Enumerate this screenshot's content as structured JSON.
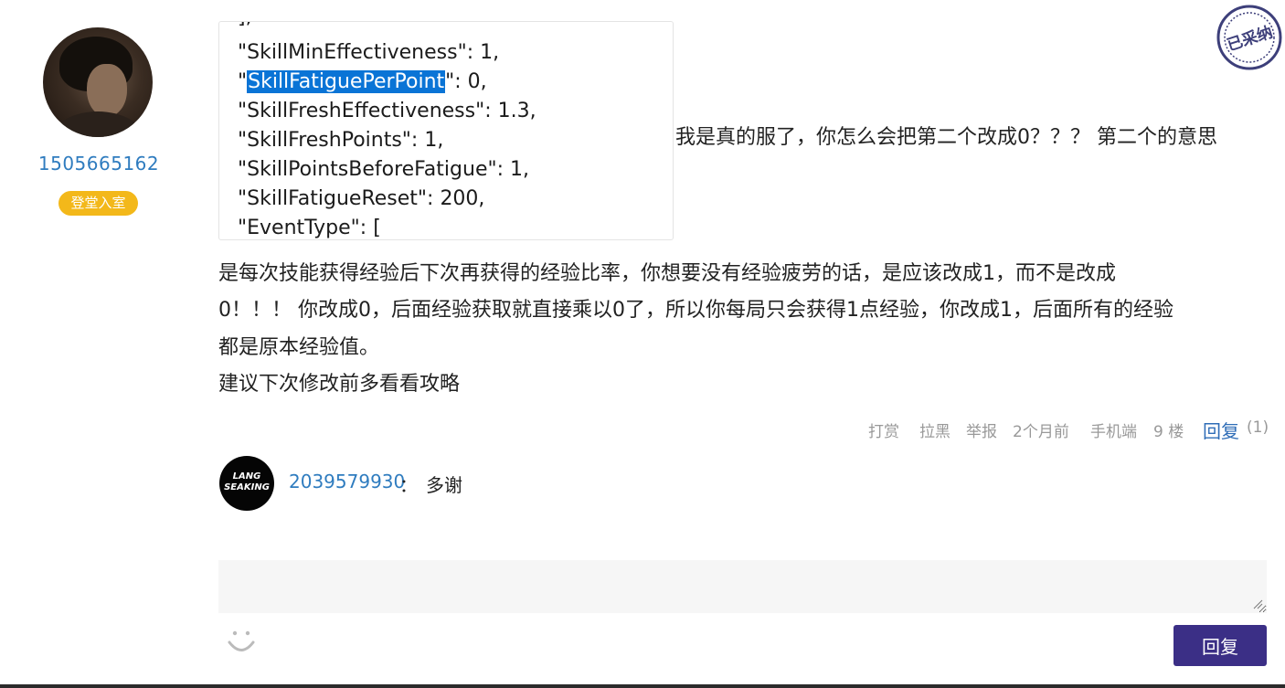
{
  "user": {
    "id": "1505665162",
    "badge": "登堂入室"
  },
  "stamp": {
    "text": "已采纳"
  },
  "code_snippet": {
    "lines": [
      "\"SkillMinEffectiveness\": 1,",
      "\"SkillFatiguePerPoint\": 0,",
      "\"SkillFreshEffectiveness\": 1.3,",
      "\"SkillFreshPoints\": 1,",
      "\"SkillPointsBeforeFatigue\": 1,",
      "\"SkillFatigueReset\": 200,",
      "\"EventType\": ["
    ],
    "highlight": "SkillFatiguePerPoint"
  },
  "post": {
    "inline_text": "我是真的服了，你怎么会把第二个改成0？？？ 第二个的意思",
    "paragraph_lines": [
      "是每次技能获得经验后下次再获得的经验比率，你想要没有经验疲劳的话，是应该改成1，而不是改成",
      "0！！！ 你改成0，后面经验获取就直接乘以0了，所以你每局只会获得1点经验，你改成1，后面所有的经验",
      "都是原本经验值。",
      "建议下次修改前多看看攻略"
    ]
  },
  "meta": {
    "reward": "打赏",
    "block": "拉黑",
    "report": "举报",
    "time": "2个月前",
    "device": "手机端",
    "floor": "9 楼",
    "reply_label": "回复",
    "reply_count": "(1)"
  },
  "sub_reply": {
    "avatar_text_1": "LANG",
    "avatar_text_2": "SEAKING",
    "user": "2039579930",
    "colon": "：",
    "text": "多谢"
  },
  "reply_box": {
    "placeholder": "",
    "submit_label": "回复"
  }
}
